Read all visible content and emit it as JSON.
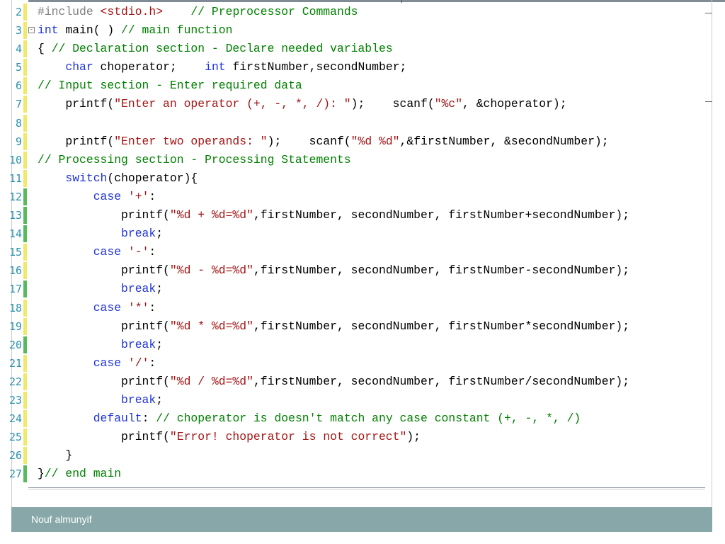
{
  "editor": {
    "lines": [
      {
        "num": "2",
        "bar": "changed",
        "fold": "",
        "tokens": [
          {
            "t": "#include ",
            "c": "pre"
          },
          {
            "t": "<stdio.h>",
            "c": "str"
          },
          {
            "t": "    ",
            "c": "def"
          },
          {
            "t": "// Preprocessor Commands",
            "c": "com"
          }
        ]
      },
      {
        "num": "3",
        "bar": "changed",
        "fold": "-",
        "tokens": [
          {
            "t": "int",
            "c": "kw"
          },
          {
            "t": " main( ) ",
            "c": "def"
          },
          {
            "t": "// main function",
            "c": "com"
          }
        ]
      },
      {
        "num": "4",
        "bar": "changed",
        "fold": "",
        "tokens": [
          {
            "t": "{ ",
            "c": "def"
          },
          {
            "t": "// Declaration section - Declare needed variables",
            "c": "com"
          }
        ]
      },
      {
        "num": "5",
        "bar": "changed",
        "fold": "",
        "tokens": [
          {
            "t": "    ",
            "c": "def"
          },
          {
            "t": "char",
            "c": "kw"
          },
          {
            "t": " choperator;    ",
            "c": "def"
          },
          {
            "t": "int",
            "c": "kw"
          },
          {
            "t": " firstNumber,secondNumber;",
            "c": "def"
          }
        ]
      },
      {
        "num": "6",
        "bar": "changed",
        "fold": "",
        "tokens": [
          {
            "t": "// Input section - Enter required data",
            "c": "com"
          }
        ]
      },
      {
        "num": "7",
        "bar": "changed",
        "fold": "",
        "tokens": [
          {
            "t": "    printf(",
            "c": "def"
          },
          {
            "t": "\"Enter an operator (+, -, *, /): \"",
            "c": "str"
          },
          {
            "t": ");    scanf(",
            "c": "def"
          },
          {
            "t": "\"%c\"",
            "c": "str"
          },
          {
            "t": ", &choperator);",
            "c": "def"
          }
        ]
      },
      {
        "num": "8",
        "bar": "changed",
        "fold": "",
        "tokens": []
      },
      {
        "num": "9",
        "bar": "changed",
        "fold": "",
        "tokens": [
          {
            "t": "    printf(",
            "c": "def"
          },
          {
            "t": "\"Enter two operands: \"",
            "c": "str"
          },
          {
            "t": ");    scanf(",
            "c": "def"
          },
          {
            "t": "\"%d %d\"",
            "c": "str"
          },
          {
            "t": ",&firstNumber, &secondNumber);",
            "c": "def"
          }
        ]
      },
      {
        "num": "10",
        "bar": "changed",
        "fold": "",
        "tokens": [
          {
            "t": "// Processing section - Processing Statements",
            "c": "com"
          }
        ]
      },
      {
        "num": "11",
        "bar": "changed",
        "fold": "",
        "tokens": [
          {
            "t": "    ",
            "c": "def"
          },
          {
            "t": "switch",
            "c": "kw"
          },
          {
            "t": "(choperator){",
            "c": "def"
          }
        ]
      },
      {
        "num": "12",
        "bar": "saved",
        "fold": "",
        "tokens": [
          {
            "t": "        ",
            "c": "def"
          },
          {
            "t": "case",
            "c": "kw"
          },
          {
            "t": " ",
            "c": "def"
          },
          {
            "t": "'+'",
            "c": "str"
          },
          {
            "t": ":",
            "c": "def"
          }
        ]
      },
      {
        "num": "13",
        "bar": "saved",
        "fold": "",
        "tokens": [
          {
            "t": "            printf(",
            "c": "def"
          },
          {
            "t": "\"%d + %d=%d\"",
            "c": "str"
          },
          {
            "t": ",firstNumber, secondNumber, firstNumber+secondNumber);",
            "c": "def"
          }
        ]
      },
      {
        "num": "14",
        "bar": "saved",
        "fold": "",
        "tokens": [
          {
            "t": "            ",
            "c": "def"
          },
          {
            "t": "break",
            "c": "kw"
          },
          {
            "t": ";",
            "c": "def"
          }
        ]
      },
      {
        "num": "15",
        "bar": "changed",
        "fold": "",
        "tokens": [
          {
            "t": "        ",
            "c": "def"
          },
          {
            "t": "case",
            "c": "kw"
          },
          {
            "t": " ",
            "c": "def"
          },
          {
            "t": "'-'",
            "c": "str"
          },
          {
            "t": ":",
            "c": "def"
          }
        ]
      },
      {
        "num": "16",
        "bar": "changed",
        "fold": "",
        "tokens": [
          {
            "t": "            printf(",
            "c": "def"
          },
          {
            "t": "\"%d - %d=%d\"",
            "c": "str"
          },
          {
            "t": ",firstNumber, secondNumber, firstNumber-secondNumber);",
            "c": "def"
          }
        ]
      },
      {
        "num": "17",
        "bar": "saved",
        "fold": "",
        "tokens": [
          {
            "t": "            ",
            "c": "def"
          },
          {
            "t": "break",
            "c": "kw"
          },
          {
            "t": ";",
            "c": "def"
          }
        ]
      },
      {
        "num": "18",
        "bar": "changed",
        "fold": "",
        "tokens": [
          {
            "t": "        ",
            "c": "def"
          },
          {
            "t": "case",
            "c": "kw"
          },
          {
            "t": " ",
            "c": "def"
          },
          {
            "t": "'*'",
            "c": "str"
          },
          {
            "t": ":",
            "c": "def"
          }
        ]
      },
      {
        "num": "19",
        "bar": "changed",
        "fold": "",
        "tokens": [
          {
            "t": "            printf(",
            "c": "def"
          },
          {
            "t": "\"%d * %d=%d\"",
            "c": "str"
          },
          {
            "t": ",firstNumber, secondNumber, firstNumber*secondNumber);",
            "c": "def"
          }
        ]
      },
      {
        "num": "20",
        "bar": "saved",
        "fold": "",
        "tokens": [
          {
            "t": "            ",
            "c": "def"
          },
          {
            "t": "break",
            "c": "kw"
          },
          {
            "t": ";",
            "c": "def"
          }
        ]
      },
      {
        "num": "21",
        "bar": "changed",
        "fold": "",
        "tokens": [
          {
            "t": "        ",
            "c": "def"
          },
          {
            "t": "case",
            "c": "kw"
          },
          {
            "t": " ",
            "c": "def"
          },
          {
            "t": "'/'",
            "c": "str"
          },
          {
            "t": ":",
            "c": "def"
          }
        ]
      },
      {
        "num": "22",
        "bar": "changed",
        "fold": "",
        "tokens": [
          {
            "t": "            printf(",
            "c": "def"
          },
          {
            "t": "\"%d / %d=%d\"",
            "c": "str"
          },
          {
            "t": ",firstNumber, secondNumber, firstNumber/secondNumber);",
            "c": "def"
          }
        ]
      },
      {
        "num": "23",
        "bar": "changed",
        "fold": "",
        "tokens": [
          {
            "t": "            ",
            "c": "def"
          },
          {
            "t": "break",
            "c": "kw"
          },
          {
            "t": ";",
            "c": "def"
          }
        ]
      },
      {
        "num": "24",
        "bar": "changed",
        "fold": "",
        "tokens": [
          {
            "t": "        ",
            "c": "def"
          },
          {
            "t": "default",
            "c": "kw"
          },
          {
            "t": ": ",
            "c": "def"
          },
          {
            "t": "// choperator is doesn't match any case constant (+, -, *, /)",
            "c": "com"
          }
        ]
      },
      {
        "num": "25",
        "bar": "changed",
        "fold": "",
        "tokens": [
          {
            "t": "            printf(",
            "c": "def"
          },
          {
            "t": "\"Error! choperator is not correct\"",
            "c": "str"
          },
          {
            "t": ");",
            "c": "def"
          }
        ]
      },
      {
        "num": "26",
        "bar": "changed",
        "fold": "",
        "tokens": [
          {
            "t": "    }",
            "c": "def"
          }
        ]
      },
      {
        "num": "27",
        "bar": "saved",
        "fold": "",
        "tokens": [
          {
            "t": "}",
            "c": "def"
          },
          {
            "t": "// end main",
            "c": "com"
          }
        ]
      }
    ]
  },
  "footer": {
    "author": "Nouf almunyif"
  },
  "colors": {
    "keyword": "#1f34d8",
    "string": "#a31515",
    "comment": "#008000",
    "preprocessor": "#808080",
    "line_number": "#2b91af",
    "saved_bar": "#57bb5c",
    "changed_bar": "#f0e96a",
    "footer_bg": "#88a7a8"
  }
}
